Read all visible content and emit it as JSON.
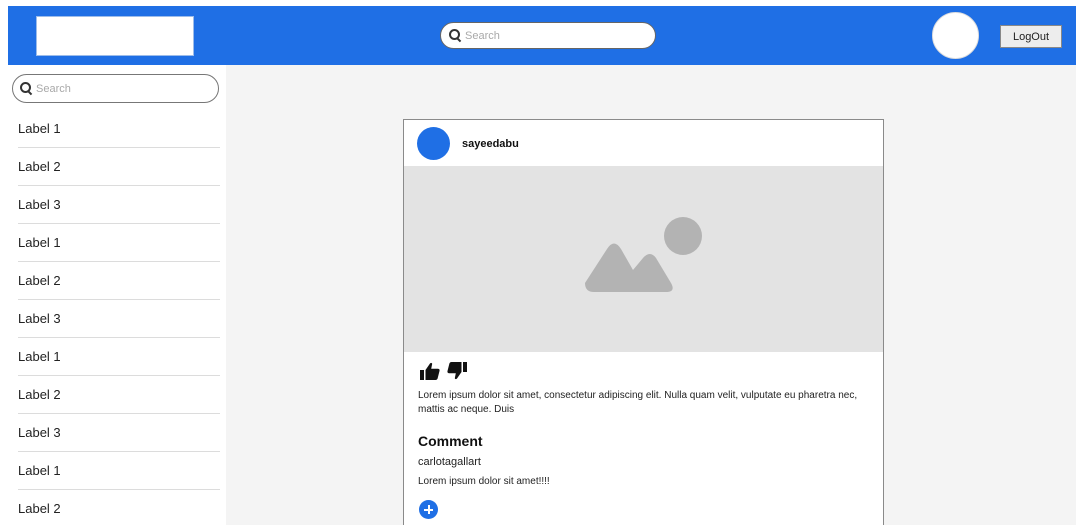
{
  "header": {
    "search": {
      "placeholder": "Search",
      "icon": "search-icon"
    },
    "logout_label": "LogOut",
    "brand_color": "#1f6fe5"
  },
  "sidebar": {
    "search": {
      "placeholder": "Search",
      "icon": "search-icon"
    },
    "items": [
      {
        "label": "Label 1"
      },
      {
        "label": "Label 2"
      },
      {
        "label": "Label 3"
      },
      {
        "label": "Label 1"
      },
      {
        "label": "Label 2"
      },
      {
        "label": "Label 3"
      },
      {
        "label": "Label 1"
      },
      {
        "label": "Label 2"
      },
      {
        "label": "Label 3"
      },
      {
        "label": "Label 1"
      },
      {
        "label": "Label 2"
      }
    ]
  },
  "post": {
    "username": "sayeedabu",
    "image_icon": "image-placeholder-icon",
    "reactions": [
      "thumbs-up-icon",
      "thumbs-down-icon"
    ],
    "text": "Lorem ipsum dolor sit amet, consectetur adipiscing elit. Nulla quam velit, vulputate eu pharetra nec, mattis ac neque. Duis",
    "comment_heading": "Comment",
    "comments": [
      {
        "user": "carlotagallart",
        "text": "Lorem ipsum dolor sit amet!!!!"
      }
    ],
    "add_comment_icon": "plus-circle-icon"
  }
}
